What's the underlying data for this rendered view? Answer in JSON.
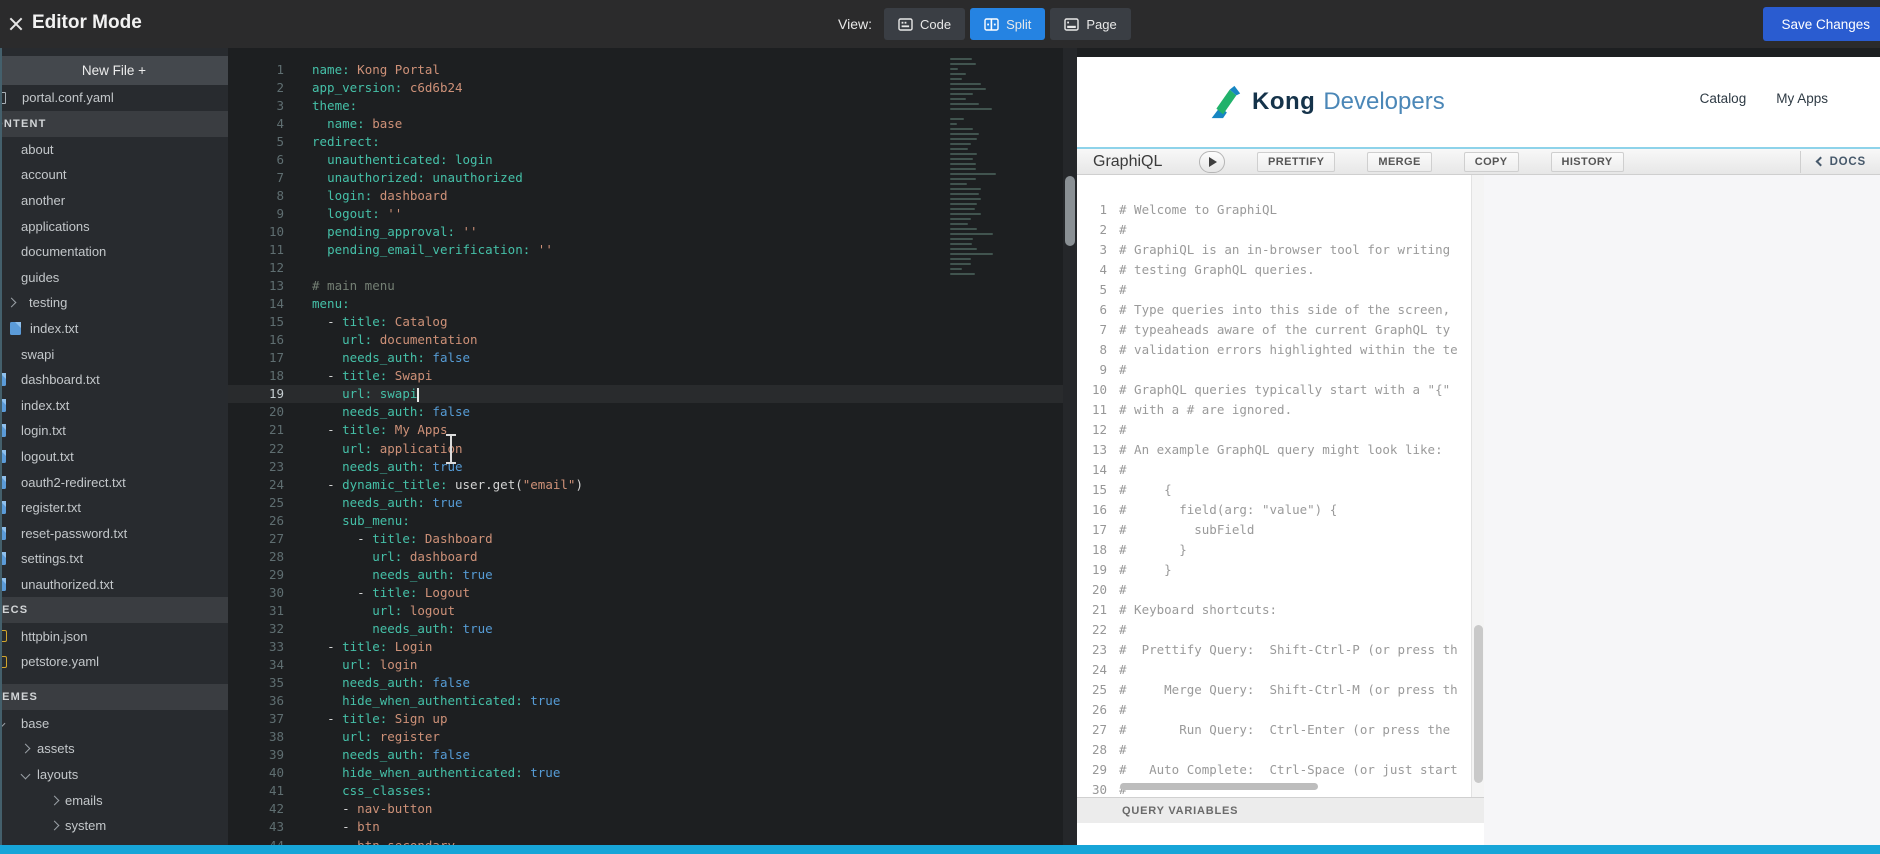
{
  "topbar": {
    "title": "Editor Mode",
    "view_label": "View:",
    "view_buttons": [
      {
        "label": "Code",
        "active": false
      },
      {
        "label": "Split",
        "active": true
      },
      {
        "label": "Page",
        "active": false
      }
    ],
    "save_button": "Save Changes"
  },
  "sidebar": {
    "new_file": "New File +",
    "root_file": "portal.conf.yaml",
    "sections": [
      {
        "label": "CONTENT",
        "items": [
          {
            "label": "about",
            "icon": "none",
            "level": 1
          },
          {
            "label": "account",
            "icon": "none",
            "level": 1
          },
          {
            "label": "another",
            "icon": "none",
            "level": 1
          },
          {
            "label": "applications",
            "icon": "none",
            "level": 1
          },
          {
            "label": "documentation",
            "icon": "none",
            "level": 1
          },
          {
            "label": "guides",
            "icon": "none",
            "level": 1
          },
          {
            "label": "testing",
            "icon": "chevron-right",
            "level": 1
          },
          {
            "label": "index.txt",
            "icon": "file-blue",
            "level": 2
          },
          {
            "label": "swapi",
            "icon": "none",
            "level": 1
          },
          {
            "label": "dashboard.txt",
            "icon": "file-blue-clipped",
            "level": 1
          },
          {
            "label": "index.txt",
            "icon": "file-blue-clipped",
            "level": 1
          },
          {
            "label": "login.txt",
            "icon": "file-blue-clipped",
            "level": 1
          },
          {
            "label": "logout.txt",
            "icon": "file-blue-clipped",
            "level": 1
          },
          {
            "label": "oauth2-redirect.txt",
            "icon": "file-blue-clipped",
            "level": 1
          },
          {
            "label": "register.txt",
            "icon": "file-blue-clipped",
            "level": 1
          },
          {
            "label": "reset-password.txt",
            "icon": "file-blue-clipped",
            "level": 1
          },
          {
            "label": "settings.txt",
            "icon": "file-blue-clipped",
            "level": 1
          },
          {
            "label": "unauthorized.txt",
            "icon": "file-blue-clipped",
            "level": 1
          }
        ]
      },
      {
        "label": "SPECS",
        "items": [
          {
            "label": "httpbin.json",
            "icon": "file-yellow",
            "level": 1
          },
          {
            "label": "petstore.yaml",
            "icon": "file-yellow",
            "level": 1
          }
        ]
      },
      {
        "label": "THEMES",
        "items": [
          {
            "label": "base",
            "icon": "chevron-down-clipped",
            "level": 1
          },
          {
            "label": "assets",
            "icon": "chevron-right",
            "level": 2
          },
          {
            "label": "layouts",
            "icon": "chevron-down",
            "level": 2
          },
          {
            "label": "emails",
            "icon": "chevron-right",
            "level": 3
          },
          {
            "label": "system",
            "icon": "chevron-right",
            "level": 3
          }
        ]
      }
    ]
  },
  "editor": {
    "lines": [
      {
        "n": 1,
        "t": [
          [
            "k",
            "name:"
          ],
          [
            "s",
            " Kong Portal"
          ]
        ]
      },
      {
        "n": 2,
        "t": [
          [
            "k",
            "app_version:"
          ],
          [
            "s",
            " c6d6b24"
          ]
        ]
      },
      {
        "n": 3,
        "t": [
          [
            "k",
            "theme:"
          ]
        ]
      },
      {
        "n": 4,
        "t": [
          [
            "w",
            "  "
          ],
          [
            "k",
            "name:"
          ],
          [
            "s",
            " base"
          ]
        ]
      },
      {
        "n": 5,
        "t": [
          [
            "k",
            "redirect:"
          ]
        ]
      },
      {
        "n": 6,
        "t": [
          [
            "w",
            "  "
          ],
          [
            "k",
            "unauthenticated:"
          ],
          [
            "t",
            " login"
          ]
        ]
      },
      {
        "n": 7,
        "t": [
          [
            "w",
            "  "
          ],
          [
            "k",
            "unauthorized:"
          ],
          [
            "t",
            " unauthorized"
          ]
        ]
      },
      {
        "n": 8,
        "t": [
          [
            "w",
            "  "
          ],
          [
            "k",
            "login:"
          ],
          [
            "s",
            " dashboard"
          ]
        ]
      },
      {
        "n": 9,
        "t": [
          [
            "w",
            "  "
          ],
          [
            "k",
            "logout:"
          ],
          [
            "s",
            " ''"
          ]
        ]
      },
      {
        "n": 10,
        "t": [
          [
            "w",
            "  "
          ],
          [
            "k",
            "pending_approval:"
          ],
          [
            "s",
            " ''"
          ]
        ]
      },
      {
        "n": 11,
        "t": [
          [
            "w",
            "  "
          ],
          [
            "k",
            "pending_email_verification:"
          ],
          [
            "s",
            " ''"
          ]
        ]
      },
      {
        "n": 12,
        "t": []
      },
      {
        "n": 13,
        "t": [
          [
            "c",
            "# main menu"
          ]
        ]
      },
      {
        "n": 14,
        "t": [
          [
            "k",
            "menu:"
          ]
        ]
      },
      {
        "n": 15,
        "t": [
          [
            "w",
            "  "
          ],
          [
            "d",
            "- "
          ],
          [
            "k",
            "title:"
          ],
          [
            "s",
            " Catalog"
          ]
        ]
      },
      {
        "n": 16,
        "t": [
          [
            "w",
            "    "
          ],
          [
            "k",
            "url:"
          ],
          [
            "s",
            " documentation"
          ]
        ]
      },
      {
        "n": 17,
        "t": [
          [
            "w",
            "    "
          ],
          [
            "k",
            "needs_auth:"
          ],
          [
            "b",
            " false"
          ]
        ]
      },
      {
        "n": 18,
        "t": [
          [
            "w",
            "  "
          ],
          [
            "d",
            "- "
          ],
          [
            "k",
            "title:"
          ],
          [
            "s",
            " Swapi"
          ]
        ]
      },
      {
        "n": 19,
        "a": 1,
        "t": [
          [
            "w",
            "    "
          ],
          [
            "k",
            "url:"
          ],
          [
            "t",
            " swapi"
          ],
          [
            "caret",
            ""
          ]
        ]
      },
      {
        "n": 20,
        "t": [
          [
            "w",
            "    "
          ],
          [
            "k",
            "needs_auth:"
          ],
          [
            "b",
            " false"
          ]
        ]
      },
      {
        "n": 21,
        "t": [
          [
            "w",
            "  "
          ],
          [
            "d",
            "- "
          ],
          [
            "k",
            "title:"
          ],
          [
            "s",
            " My Apps"
          ]
        ]
      },
      {
        "n": 22,
        "t": [
          [
            "w",
            "    "
          ],
          [
            "k",
            "url:"
          ],
          [
            "s",
            " application"
          ]
        ]
      },
      {
        "n": 23,
        "t": [
          [
            "w",
            "    "
          ],
          [
            "k",
            "needs_auth:"
          ],
          [
            "b",
            " true"
          ]
        ]
      },
      {
        "n": 24,
        "t": [
          [
            "w",
            "  "
          ],
          [
            "d",
            "- "
          ],
          [
            "k",
            "dynamic_title:"
          ],
          [
            "w",
            " user.get("
          ],
          [
            "s",
            "\"email\""
          ],
          [
            "w",
            ")"
          ]
        ]
      },
      {
        "n": 25,
        "t": [
          [
            "w",
            "    "
          ],
          [
            "k",
            "needs_auth:"
          ],
          [
            "b",
            " true"
          ]
        ]
      },
      {
        "n": 26,
        "t": [
          [
            "w",
            "    "
          ],
          [
            "k",
            "sub_menu:"
          ]
        ]
      },
      {
        "n": 27,
        "t": [
          [
            "w",
            "      "
          ],
          [
            "d",
            "- "
          ],
          [
            "k",
            "title:"
          ],
          [
            "s",
            " Dashboard"
          ]
        ]
      },
      {
        "n": 28,
        "t": [
          [
            "w",
            "        "
          ],
          [
            "k",
            "url:"
          ],
          [
            "s",
            " dashboard"
          ]
        ]
      },
      {
        "n": 29,
        "t": [
          [
            "w",
            "        "
          ],
          [
            "k",
            "needs_auth:"
          ],
          [
            "b",
            " true"
          ]
        ]
      },
      {
        "n": 30,
        "t": [
          [
            "w",
            "      "
          ],
          [
            "d",
            "- "
          ],
          [
            "k",
            "title:"
          ],
          [
            "s",
            " Logout"
          ]
        ]
      },
      {
        "n": 31,
        "t": [
          [
            "w",
            "        "
          ],
          [
            "k",
            "url:"
          ],
          [
            "s",
            " logout"
          ]
        ]
      },
      {
        "n": 32,
        "t": [
          [
            "w",
            "        "
          ],
          [
            "k",
            "needs_auth:"
          ],
          [
            "b",
            " true"
          ]
        ]
      },
      {
        "n": 33,
        "t": [
          [
            "w",
            "  "
          ],
          [
            "d",
            "- "
          ],
          [
            "k",
            "title:"
          ],
          [
            "s",
            " Login"
          ]
        ]
      },
      {
        "n": 34,
        "t": [
          [
            "w",
            "    "
          ],
          [
            "k",
            "url:"
          ],
          [
            "s",
            " login"
          ]
        ]
      },
      {
        "n": 35,
        "t": [
          [
            "w",
            "    "
          ],
          [
            "k",
            "needs_auth:"
          ],
          [
            "b",
            " false"
          ]
        ]
      },
      {
        "n": 36,
        "t": [
          [
            "w",
            "    "
          ],
          [
            "k",
            "hide_when_authenticated:"
          ],
          [
            "b",
            " true"
          ]
        ]
      },
      {
        "n": 37,
        "t": [
          [
            "w",
            "  "
          ],
          [
            "d",
            "- "
          ],
          [
            "k",
            "title:"
          ],
          [
            "s",
            " Sign up"
          ]
        ]
      },
      {
        "n": 38,
        "t": [
          [
            "w",
            "    "
          ],
          [
            "k",
            "url:"
          ],
          [
            "s",
            " register"
          ]
        ]
      },
      {
        "n": 39,
        "t": [
          [
            "w",
            "    "
          ],
          [
            "k",
            "needs_auth:"
          ],
          [
            "b",
            " false"
          ]
        ]
      },
      {
        "n": 40,
        "t": [
          [
            "w",
            "    "
          ],
          [
            "k",
            "hide_when_authenticated:"
          ],
          [
            "b",
            " true"
          ]
        ]
      },
      {
        "n": 41,
        "t": [
          [
            "w",
            "    "
          ],
          [
            "k",
            "css_classes:"
          ]
        ]
      },
      {
        "n": 42,
        "t": [
          [
            "w",
            "    "
          ],
          [
            "d",
            "- "
          ],
          [
            "s",
            "nav-button"
          ]
        ]
      },
      {
        "n": 43,
        "t": [
          [
            "w",
            "    "
          ],
          [
            "d",
            "- "
          ],
          [
            "s",
            "btn"
          ]
        ]
      },
      {
        "n": 44,
        "t": [
          [
            "w",
            "    "
          ],
          [
            "d",
            "- "
          ],
          [
            "s",
            "btn-secondary"
          ]
        ]
      }
    ]
  },
  "preview": {
    "brand": {
      "name": "Kong",
      "suffix": "Developers"
    },
    "nav": [
      "Catalog",
      "My Apps"
    ],
    "graphiql": {
      "title": "GraphiQL",
      "buttons": [
        "PRETTIFY",
        "MERGE",
        "COPY",
        "HISTORY"
      ],
      "docs_label": "DOCS",
      "query_variables_label": "QUERY VARIABLES",
      "query_lines": [
        "# Welcome to GraphiQL",
        "#",
        "# GraphiQL is an in-browser tool for writing",
        "# testing GraphQL queries.",
        "#",
        "# Type queries into this side of the screen,",
        "# typeaheads aware of the current GraphQL ty",
        "# validation errors highlighted within the te",
        "#",
        "# GraphQL queries typically start with a \"{\"",
        "# with a # are ignored.",
        "#",
        "# An example GraphQL query might look like:",
        "#",
        "#     {",
        "#       field(arg: \"value\") {",
        "#         subField",
        "#       }",
        "#     }",
        "#",
        "# Keyboard shortcuts:",
        "#",
        "#  Prettify Query:  Shift-Ctrl-P (or press th",
        "#",
        "#     Merge Query:  Shift-Ctrl-M (or press th",
        "#",
        "#       Run Query:  Ctrl-Enter (or press the",
        "#",
        "#   Auto Complete:  Ctrl-Space (or just start",
        "#"
      ]
    }
  },
  "colors": {
    "split_active_blue": "#2583e2",
    "save_blue": "#2a5cd0",
    "bottom_bar_blue": "#17a5d8",
    "kong_green": "#21b26b",
    "kong_blue": "#1786c2",
    "kong_text_navy": "#15334a",
    "kong_developers_blue": "#4b87b7",
    "file_icon_blue": "#5b9bd8",
    "file_icon_yellow": "#d2a62c",
    "yaml_key_teal": "#45c0a8",
    "yaml_string_salmon": "#ce9178",
    "yaml_bool_blue": "#569cd6"
  }
}
